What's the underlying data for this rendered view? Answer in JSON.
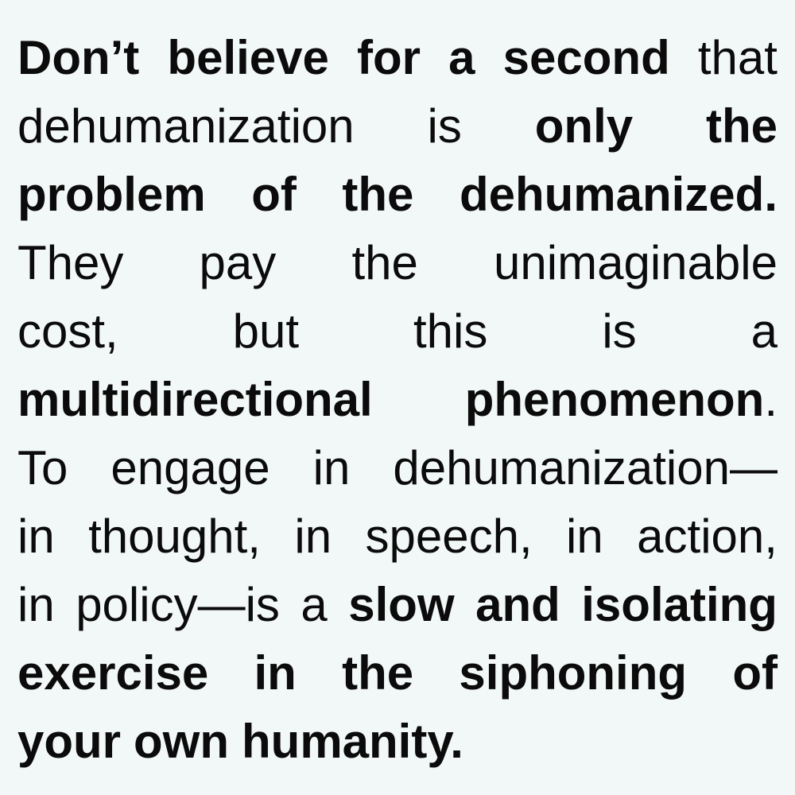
{
  "quote": {
    "lines": [
      {
        "words": [
          {
            "t": "Don’t",
            "b": true
          },
          {
            "t": "believe",
            "b": true
          },
          {
            "t": "for",
            "b": true
          },
          {
            "t": "a",
            "b": true
          },
          {
            "t": "second",
            "b": true
          },
          {
            "t": "that",
            "b": false
          }
        ]
      },
      {
        "words": [
          {
            "t": "dehumanization",
            "b": false
          },
          {
            "t": "is",
            "b": false
          },
          {
            "t": "only",
            "b": true
          },
          {
            "t": "the",
            "b": true
          }
        ]
      },
      {
        "words": [
          {
            "t": "problem",
            "b": true
          },
          {
            "t": "of",
            "b": true
          },
          {
            "t": "the",
            "b": true
          },
          {
            "t": "dehumanized.",
            "b": true
          }
        ]
      },
      {
        "words": [
          {
            "t": "They",
            "b": false
          },
          {
            "t": "pay",
            "b": false
          },
          {
            "t": "the",
            "b": false
          },
          {
            "t": "unimaginable",
            "b": false
          }
        ]
      },
      {
        "words": [
          {
            "t": "cost,",
            "b": false
          },
          {
            "t": "but",
            "b": false
          },
          {
            "t": "this",
            "b": false
          },
          {
            "t": "is",
            "b": false
          },
          {
            "t": "a",
            "b": false
          }
        ]
      },
      {
        "words": [
          {
            "t": "multidirectional",
            "b": true
          },
          {
            "t": "phenomenon",
            "b": true
          },
          {
            "t": ".",
            "b": false
          }
        ]
      },
      {
        "words": [
          {
            "t": "To",
            "b": false
          },
          {
            "t": "engage",
            "b": false
          },
          {
            "t": "in",
            "b": false
          },
          {
            "t": "dehumanization—",
            "b": false
          }
        ]
      },
      {
        "words": [
          {
            "t": "in",
            "b": false
          },
          {
            "t": "thought,",
            "b": false
          },
          {
            "t": "in",
            "b": false
          },
          {
            "t": "speech,",
            "b": false
          },
          {
            "t": "in",
            "b": false
          },
          {
            "t": "action,",
            "b": false
          }
        ]
      },
      {
        "words": [
          {
            "t": "in",
            "b": false
          },
          {
            "t": "policy—is",
            "b": false
          },
          {
            "t": "a",
            "b": false
          },
          {
            "t": "slow",
            "b": true
          },
          {
            "t": "and",
            "b": true
          },
          {
            "t": "isolating",
            "b": true
          }
        ]
      },
      {
        "words": [
          {
            "t": "exercise",
            "b": true
          },
          {
            "t": "in",
            "b": true
          },
          {
            "t": "the",
            "b": true
          },
          {
            "t": "siphoning",
            "b": true
          },
          {
            "t": "of",
            "b": true
          }
        ]
      },
      {
        "words": [
          {
            "t": "your",
            "b": true
          },
          {
            "t": "own",
            "b": true
          },
          {
            "t": "humanity.",
            "b": true
          }
        ]
      }
    ]
  }
}
